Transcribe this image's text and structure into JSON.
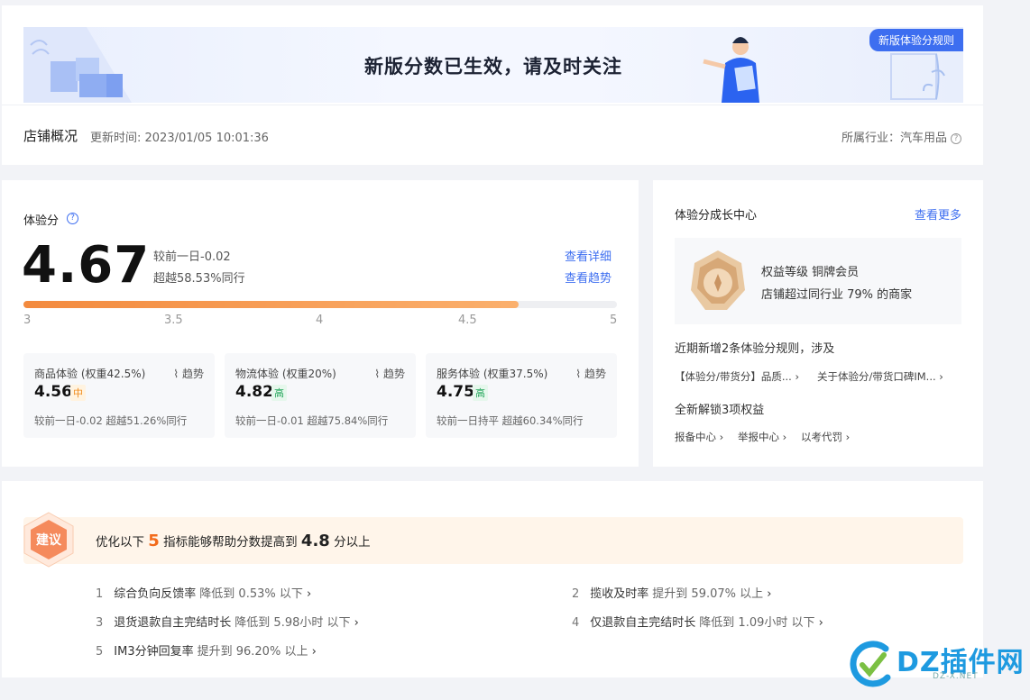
{
  "banner": {
    "headline": "新版分数已生效，请及时关注",
    "tag": "新版体验分规则"
  },
  "overview": {
    "title": "店铺概况",
    "update_time": "更新时间: 2023/01/05 10:01:36",
    "industry": "所属行业：汽车用品"
  },
  "score": {
    "label": "体验分",
    "value": "4.67",
    "vs_yesterday": "较前一日-0.02",
    "vs_peer": "超越58.53%同行",
    "link_detail": "查看详细",
    "link_trend": "查看趋势",
    "progress_value": 4.67,
    "scale": [
      "3",
      "3.5",
      "4",
      "4.5",
      "5"
    ],
    "sub_scores": [
      {
        "name": "商品体验 (权重42.5%)",
        "trend": "趋势",
        "value": "4.56",
        "level": "中",
        "foot": "较前一日-0.02  超越51.26%同行"
      },
      {
        "name": "物流体验 (权重20%)",
        "trend": "趋势",
        "value": "4.82",
        "level": "高",
        "foot": "较前一日-0.01  超越75.84%同行"
      },
      {
        "name": "服务体验 (权重37.5%)",
        "trend": "趋势",
        "value": "4.75",
        "level": "高",
        "foot": "较前一日持平  超越60.34%同行"
      }
    ]
  },
  "growth": {
    "title": "体验分成长中心",
    "more": "查看更多",
    "member_level": "权益等级 铜牌会员",
    "member_desc": "店铺超过同行业 79% 的商家",
    "new_rules": "近期新增2条体验分规则，涉及",
    "rule_links": [
      "【体验分/带货分】品质...",
      "关于体验分/带货口碑IM..."
    ],
    "unlock": "全新解锁3项权益",
    "perks": [
      "报备中心",
      "举报中心",
      "以考代罚"
    ]
  },
  "suggestion": {
    "badge": "建议",
    "prefix": "优化以下",
    "count": "5",
    "middle": "指标能够帮助分数提高到",
    "target": "4.8",
    "suffix": "分以上",
    "items": [
      {
        "idx": "1",
        "name": "综合负向反馈率",
        "action": "降低到 0.53% 以下"
      },
      {
        "idx": "2",
        "name": "揽收及时率",
        "action": "提升到 59.07% 以上"
      },
      {
        "idx": "3",
        "name": "退货退款自主完结时长",
        "action": "降低到 5.98小时 以下"
      },
      {
        "idx": "4",
        "name": "仅退款自主完结时长",
        "action": "降低到 1.09小时 以下"
      },
      {
        "idx": "5",
        "name": "IM3分钟回复率",
        "action": "提升到 96.20% 以上"
      }
    ]
  },
  "watermark": {
    "text": "DZ插件网",
    "sub": "DZ-X.NET"
  }
}
